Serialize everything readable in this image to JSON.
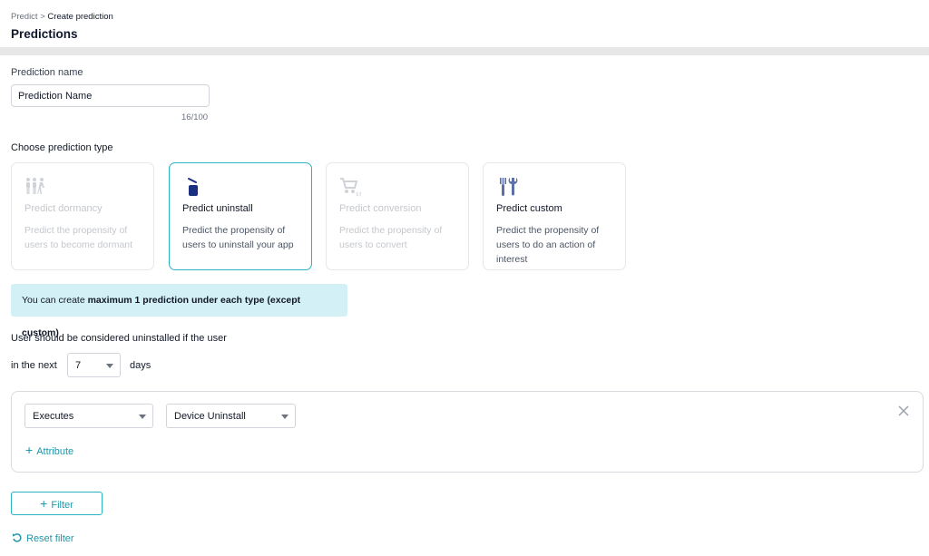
{
  "header": {
    "breadcrumb_parent": "Predict",
    "breadcrumb_sep": ">",
    "breadcrumb_current": "Create prediction",
    "title": "Predictions"
  },
  "form": {
    "name_label": "Prediction name",
    "name_value": "Prediction Name",
    "name_counter": "16/100",
    "type_label": "Choose prediction type",
    "types": [
      {
        "title": "Predict dormancy",
        "desc": "Predict the propensity of users to become dormant",
        "icon": "people-icon",
        "state": "disabled"
      },
      {
        "title": "Predict uninstall",
        "desc": "Predict the propensity of users to uninstall your app",
        "icon": "uninstall-icon",
        "state": "selected"
      },
      {
        "title": "Predict conversion",
        "desc": "Predict the propensity of users to convert",
        "icon": "cart-icon",
        "state": "disabled"
      },
      {
        "title": "Predict custom",
        "desc": "Predict the propensity of users to do an action of interest",
        "icon": "tools-icon",
        "state": "enabled"
      }
    ],
    "info_prefix": "You can create ",
    "info_bold": "maximum 1 prediction under each type (except custom)",
    "condition_label": "User should be considered uninstalled if the user",
    "in_next_label": "in the next",
    "days_value": "7",
    "days_label": "days"
  },
  "filter": {
    "action_value": "Executes",
    "event_value": "Device Uninstall",
    "attribute_label": "Attribute",
    "add_filter_label": "Filter",
    "reset_label": "Reset filter"
  },
  "colors": {
    "accent": "#2bb3c0",
    "link": "#1f97a8",
    "info_bg": "#d3f0f6",
    "icon_navy": "#1b2f80"
  }
}
